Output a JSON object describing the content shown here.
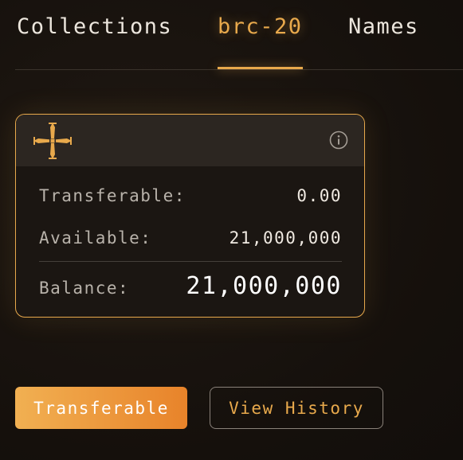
{
  "tabs": {
    "items": [
      {
        "label": "Collections",
        "active": false
      },
      {
        "label": "brc-20",
        "active": true
      },
      {
        "label": "Names",
        "active": false
      }
    ]
  },
  "token_card": {
    "logo": "cross-icon",
    "info": "info-icon",
    "transferable": {
      "label": "Transferable:",
      "value": "0.00"
    },
    "available": {
      "label": "Available:",
      "value": "21,000,000"
    },
    "balance": {
      "label": "Balance:",
      "value": "21,000,000"
    }
  },
  "actions": {
    "primary_label": "Transferable",
    "secondary_label": "View History"
  },
  "colors": {
    "accent": "#e8a94c",
    "background": "#17120e",
    "card_header": "#2c2621",
    "button_gradient_start": "#f1b052",
    "button_gradient_end": "#e8832a"
  }
}
